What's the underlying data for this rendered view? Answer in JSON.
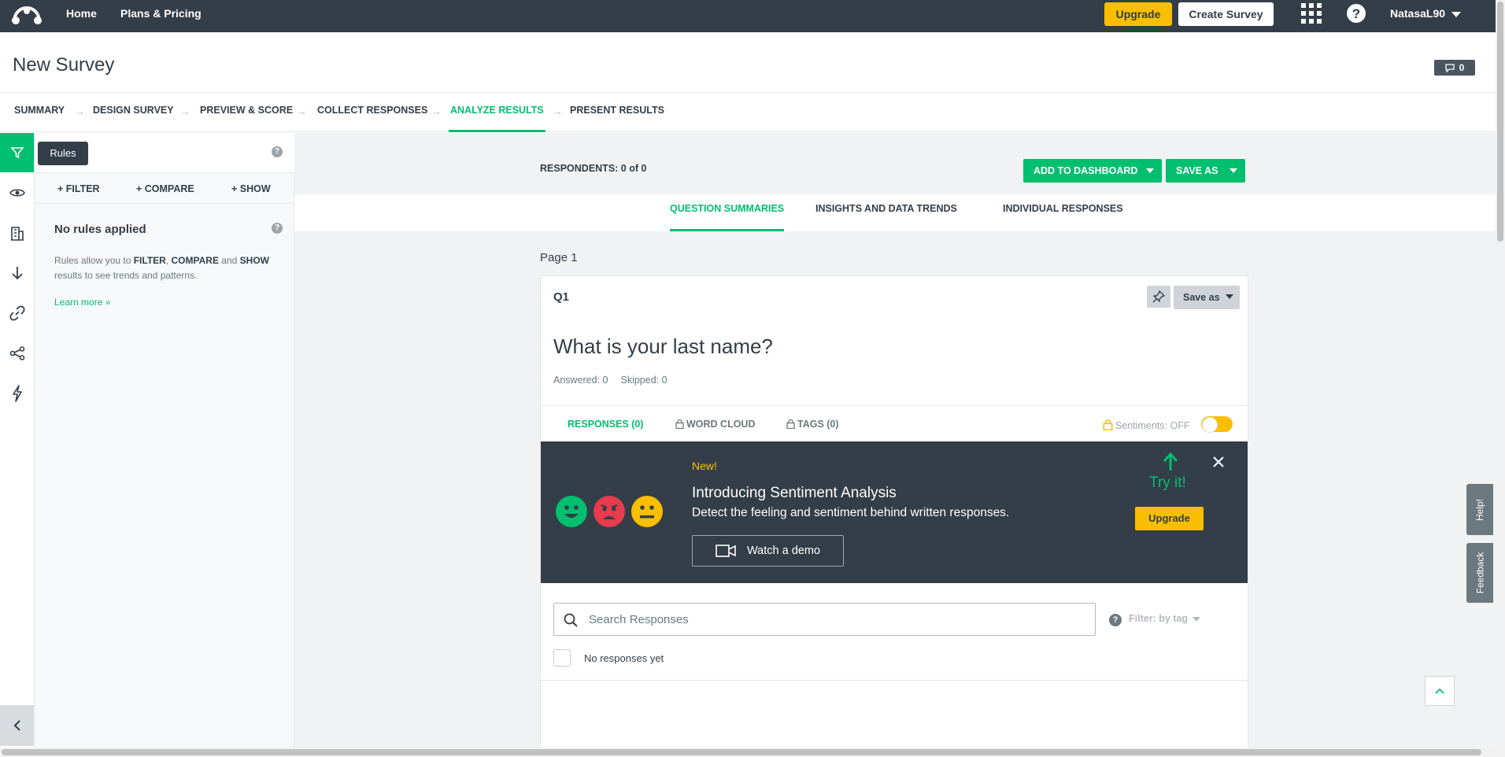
{
  "topbar": {
    "nav": [
      "Home",
      "Plans & Pricing"
    ],
    "upgrade_label": "Upgrade",
    "create_label": "Create Survey",
    "username": "NatasaL90",
    "icons": [
      "surveymonkey-logo",
      "apps-grid-icon",
      "help-icon"
    ],
    "colors": {
      "bar": "#333e48",
      "accent": "#f9be00"
    }
  },
  "header": {
    "title": "New Survey",
    "comments_count": "0"
  },
  "steps": [
    "SUMMARY",
    "DESIGN SURVEY",
    "PREVIEW & SCORE",
    "COLLECT RESPONSES",
    "ANALYZE RESULTS",
    "PRESENT RESULTS"
  ],
  "active_step": "ANALYZE RESULTS",
  "rail": {
    "tooltip": "Rules",
    "icons": [
      "filter-icon",
      "eye-icon",
      "building-icon",
      "download-icon",
      "link-icon",
      "share-icon",
      "lightning-icon",
      "chevron-left-icon"
    ]
  },
  "rules": {
    "actions": [
      "+ FILTER",
      "+ COMPARE",
      "+ SHOW"
    ],
    "title": "No rules applied",
    "desc_1": "Rules allow you to ",
    "filter": "FILTER",
    "comma": ", ",
    "compare": "COMPARE",
    "and": " and ",
    "show": "SHOW",
    "desc_2": " results to see trends and patterns.",
    "learn_more": "Learn more »"
  },
  "main": {
    "respondents": "RESPONDENTS: 0 of 0",
    "add_dashboard": "ADD TO DASHBOARD",
    "save_as": "SAVE AS",
    "tabs": [
      "QUESTION SUMMARIES",
      "INSIGHTS AND DATA TRENDS",
      "INDIVIDUAL RESPONSES"
    ],
    "page_label": "Page 1",
    "accent": "#00bf6f"
  },
  "question": {
    "number": "Q1",
    "save_as": "Save as",
    "text": "What is your last name?",
    "answered": "Answered: 0",
    "skipped": "Skipped: 0",
    "tabs": [
      "RESPONSES (0)",
      "WORD CLOUD",
      "TAGS (0)"
    ],
    "sentiments": "Sentiments: OFF"
  },
  "banner": {
    "new": "New!",
    "title": "Introducing Sentiment Analysis",
    "subtitle": "Detect the feeling and sentiment behind written responses.",
    "watch_demo": "Watch a demo",
    "try_it": "Try it!",
    "upgrade": "Upgrade"
  },
  "responses": {
    "search_placeholder": "Search Responses",
    "filter_tag": "Filter: by tag",
    "empty": "No responses yet"
  },
  "side_tabs": {
    "help": "Help!",
    "feedback": "Feedback"
  }
}
